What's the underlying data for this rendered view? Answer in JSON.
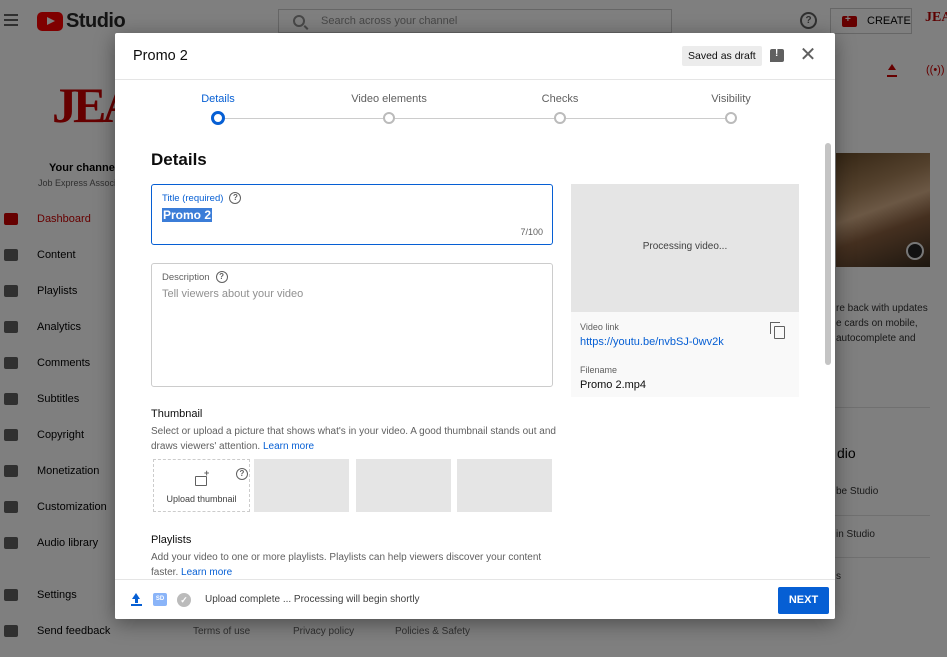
{
  "app": {
    "logo_text": "Studio",
    "search_placeholder": "Search across your channel",
    "create_label": "CREATE",
    "avatar_text": "JEA"
  },
  "sidebar": {
    "channel_logo": "JEA",
    "channel_title": "Your channel",
    "channel_subtitle": "Job Express Associates",
    "items": [
      {
        "label": "Dashboard",
        "icon": "dashboard-icon",
        "active": true
      },
      {
        "label": "Content",
        "icon": "content-icon"
      },
      {
        "label": "Playlists",
        "icon": "playlists-icon"
      },
      {
        "label": "Analytics",
        "icon": "analytics-icon"
      },
      {
        "label": "Comments",
        "icon": "comments-icon"
      },
      {
        "label": "Subtitles",
        "icon": "subtitles-icon"
      },
      {
        "label": "Copyright",
        "icon": "copyright-icon"
      },
      {
        "label": "Monetization",
        "icon": "monetization-icon"
      },
      {
        "label": "Customization",
        "icon": "customization-icon"
      },
      {
        "label": "Audio library",
        "icon": "audio-library-icon"
      }
    ],
    "settings_label": "Settings",
    "feedback_label": "Send feedback"
  },
  "background": {
    "news_lines": [
      "re back with updates",
      "e cards on mobile,",
      "autocomplete and"
    ],
    "studio_heading": "dio",
    "studio_links": [
      "be Studio",
      "in Studio",
      "s"
    ],
    "footer_links": [
      "Terms of use",
      "Privacy policy",
      "Policies & Safety"
    ]
  },
  "dialog": {
    "title": "Promo 2",
    "saved_chip": "Saved as draft",
    "steps": [
      {
        "label": "Details",
        "active": true
      },
      {
        "label": "Video elements",
        "active": false
      },
      {
        "label": "Checks",
        "active": false
      },
      {
        "label": "Visibility",
        "active": false
      }
    ],
    "section_title": "Details",
    "title_field": {
      "label": "Title (required)",
      "value": "Promo 2",
      "counter": "7/100"
    },
    "description_field": {
      "label": "Description",
      "placeholder": "Tell viewers about your video"
    },
    "preview": {
      "status": "Processing video...",
      "video_link_label": "Video link",
      "video_link": "https://youtu.be/nvbSJ-0wv2k",
      "filename_label": "Filename",
      "filename": "Promo 2.mp4"
    },
    "thumbnail": {
      "title": "Thumbnail",
      "description": "Select or upload a picture that shows what's in your video. A good thumbnail stands out and draws viewers' attention.",
      "learn_more": "Learn more",
      "upload_label": "Upload thumbnail"
    },
    "playlists": {
      "title": "Playlists",
      "description": "Add your video to one or more playlists. Playlists can help viewers discover your content faster.",
      "learn_more": "Learn more"
    },
    "footer": {
      "sd_badge": "SD",
      "status": "Upload complete ... Processing will begin shortly",
      "next_label": "NEXT"
    }
  },
  "colors": {
    "accent": "#065fd4",
    "brand": "#ff0000",
    "active_nav": "#cc0000"
  }
}
